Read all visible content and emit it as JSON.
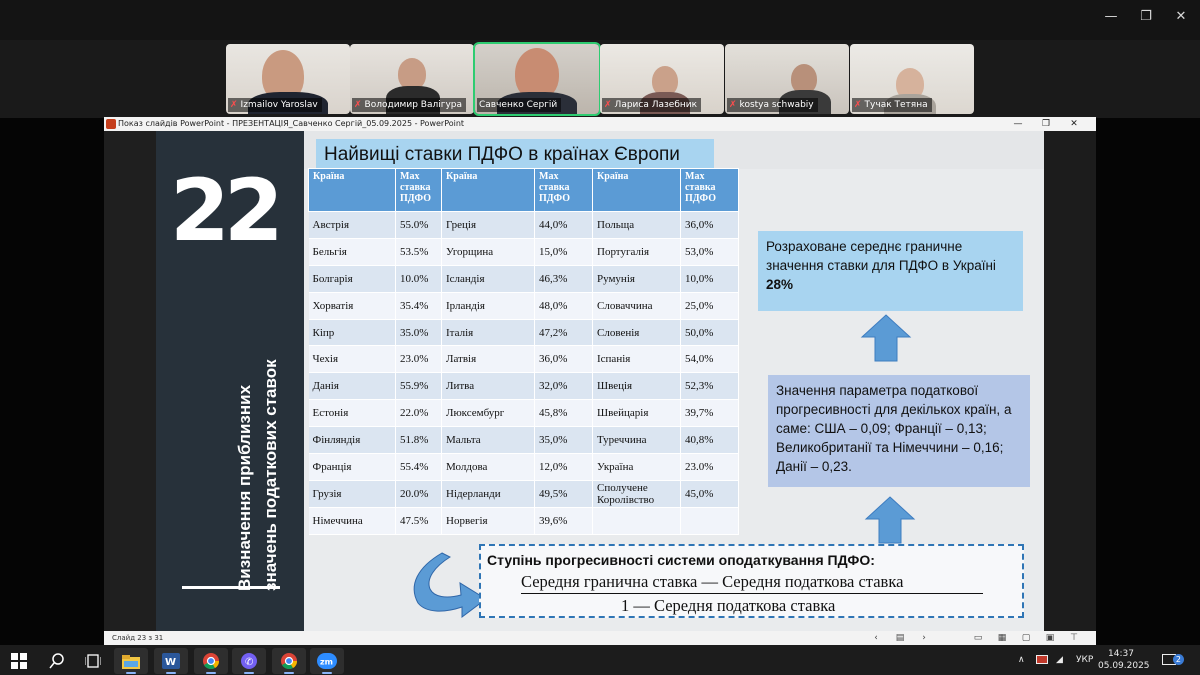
{
  "zoom": {
    "participants": [
      {
        "name": "Izmailov Yaroslav",
        "muted": true
      },
      {
        "name": "Володимир Валігура",
        "muted": true
      },
      {
        "name": "Савченко Сергій",
        "muted": false,
        "active": true
      },
      {
        "name": "Лариса Лазебник",
        "muted": true
      },
      {
        "name": "kostya schwabiy",
        "muted": true
      },
      {
        "name": "Тучак Тетяна",
        "muted": true
      }
    ]
  },
  "ppt_window": {
    "title": "Показ слайдів PowerPoint  -  ПРЕЗЕНТАЦІЯ_Савченко Сергій_05.09.2025 - PowerPoint",
    "status": "Слайд 23 з 31"
  },
  "slide": {
    "number": "22",
    "vertical_title_line1": "Визначення приблизних",
    "vertical_title_line2": "значень податкових ставок",
    "title": "Найвищі ставки ПДФО в країнах Європи",
    "table": {
      "headers": [
        "Країна",
        "Мах ставка ПДФО",
        "Країна",
        "Мах ставка ПДФО",
        "Країна",
        "Мах ставка ПДФО"
      ],
      "rows": [
        [
          "Австрія",
          "55.0%",
          "Греція",
          "44,0%",
          "Польща",
          "36,0%"
        ],
        [
          "Бельгія",
          "53.5%",
          "Угорщина",
          "15,0%",
          "Португалія",
          "53,0%"
        ],
        [
          "Болгарія",
          "10.0%",
          "Ісландія",
          "46,3%",
          "Румунія",
          "10,0%"
        ],
        [
          "Хорватія",
          "35.4%",
          "Ірландія",
          "48,0%",
          "Словаччина",
          "25,0%"
        ],
        [
          "Кіпр",
          "35.0%",
          "Італія",
          "47,2%",
          "Словенія",
          "50,0%"
        ],
        [
          "Чехія",
          "23.0%",
          "Латвія",
          "36,0%",
          "Іспанія",
          "54,0%"
        ],
        [
          "Данія",
          "55.9%",
          "Литва",
          "32,0%",
          "Швеція",
          "52,3%"
        ],
        [
          "Естонія",
          "22.0%",
          "Люксембург",
          "45,8%",
          "Швейцарія",
          "39,7%"
        ],
        [
          "Фінляндія",
          "51.8%",
          "Мальта",
          "35,0%",
          "Туреччина",
          "40,8%"
        ],
        [
          "Франція",
          "55.4%",
          "Молдова",
          "12,0%",
          "Україна",
          "23.0%"
        ],
        [
          "Грузія",
          "20.0%",
          "Нідерланди",
          "49,5%",
          "Сполучене Королівство",
          "45,0%"
        ],
        [
          "Німеччина",
          "47.5%",
          "Норвегія",
          "39,6%",
          "",
          ""
        ]
      ]
    },
    "box1": {
      "text": "Розраховане середнє граничне значення ставки для ПДФО в Україні ",
      "bold": "28%"
    },
    "box2": {
      "text": "Значення параметра податкової прогресивності для декількох країн, а саме: США – 0,09; Франції – 0,13; Великобританії та Німеччини – 0,16; Данії – 0,23."
    },
    "formula": {
      "heading": "Ступінь прогресивності системи оподаткування ПДФО:",
      "numerator": "Середня гранична ставка —  Середня податкова ставка",
      "denominator": "1 —  Середня податкова ставка"
    }
  },
  "taskbar": {
    "lang": "УКР",
    "time": "14:37",
    "date": "05.09.2025",
    "notifications": "2"
  },
  "colors": {
    "title_fill": "#a8d4f0",
    "table_header": "#5b9bd5",
    "box2_fill": "#b4c6e7",
    "arrow": "#5b9bd5",
    "zoom_active": "#2ecc71"
  }
}
